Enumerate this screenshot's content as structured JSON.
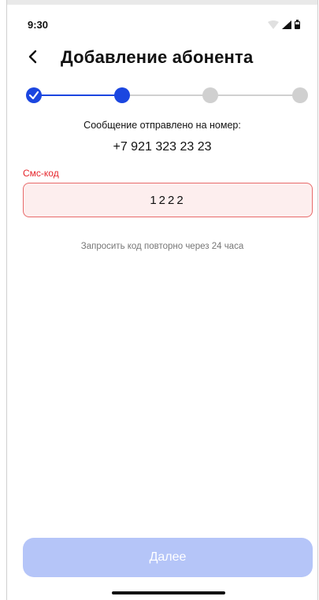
{
  "status_bar": {
    "time": "9:30",
    "icons": [
      "wifi-icon",
      "signal-icon",
      "battery-icon"
    ]
  },
  "header": {
    "back_icon": "chevron-left-icon",
    "title": "Добавление абонента"
  },
  "stepper": {
    "total_steps": 4,
    "current_step": 2,
    "colors": {
      "active": "#1b46e0",
      "inactive": "#d0d0d0"
    }
  },
  "verification": {
    "sent_label": "Сообщение отправлено на номер:",
    "phone": "+7 921 323 23 23"
  },
  "sms_field": {
    "label": "Смс-код",
    "value": "1222",
    "error_color": "#e5242a"
  },
  "resend_text": "Запросить код повторно через 24 часа",
  "next_button": {
    "label": "Далее",
    "color": "#b5c5f8"
  }
}
